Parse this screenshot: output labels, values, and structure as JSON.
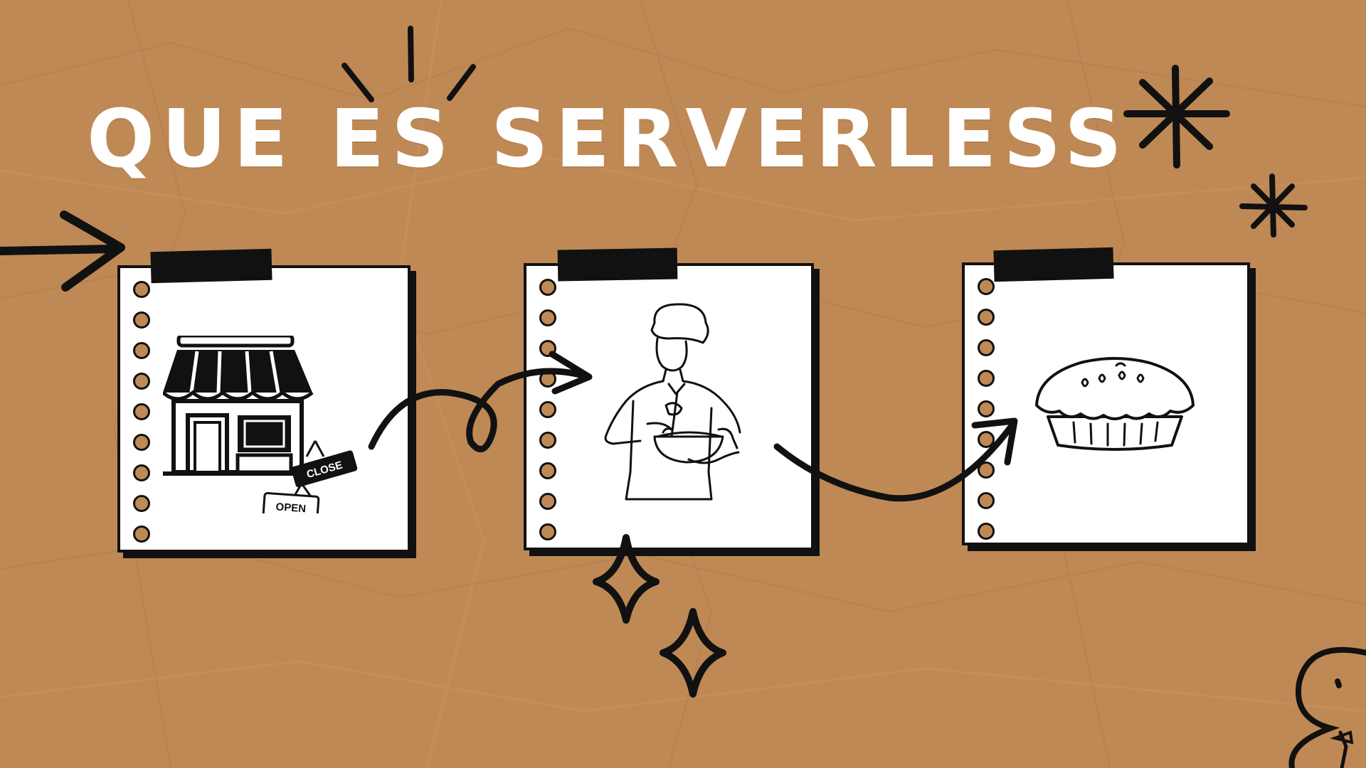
{
  "slide": {
    "title": "QUE ES SERVERLESS",
    "background_color": "#bf8955",
    "ink_color": "#111111"
  },
  "cards": [
    {
      "illustration": "storefront-icon",
      "signs": {
        "close": "CLOSE",
        "open": "OPEN"
      }
    },
    {
      "illustration": "chef-mixing-bowl-icon"
    },
    {
      "illustration": "pie-icon"
    }
  ],
  "decorations": [
    "arrow-right-icon",
    "curly-arrow-icon",
    "curved-arrow-icon",
    "asterisk-icon",
    "sparkle-icon",
    "mascot-icon"
  ]
}
